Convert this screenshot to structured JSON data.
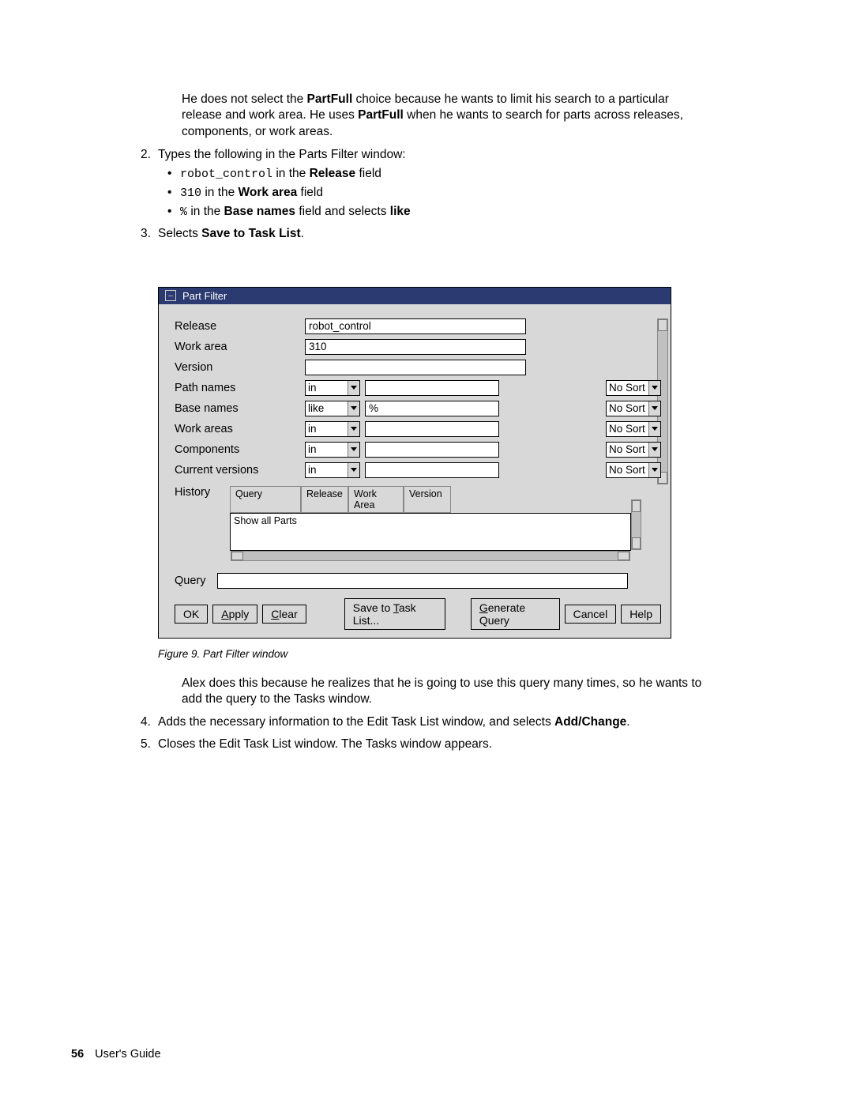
{
  "intro": {
    "p1a": "He does not select the ",
    "partfull1": "PartFull",
    "p1b": " choice because he wants to limit his search to a particular release and work area. He uses ",
    "partfull2": "PartFull",
    "p1c": " when he wants to search for parts across releases, components, or work areas."
  },
  "step2": {
    "num": "2.",
    "lead": "Types the following in the Parts Filter window:",
    "b1_code": "robot_control",
    "b1_mid": " in the ",
    "b1_field": "Release",
    "b1_end": " field",
    "b2_code": "310",
    "b2_mid": " in the ",
    "b2_field": "Work area",
    "b2_end": " field",
    "b3_code": "%",
    "b3_mid": " in the ",
    "b3_field": "Base names",
    "b3_mid2": " field and selects ",
    "b3_like": "like"
  },
  "step3": {
    "num": "3.",
    "a": "Selects ",
    "b": "Save to Task List",
    "c": "."
  },
  "window": {
    "title": "Part Filter",
    "labels": {
      "release": "Release",
      "workarea": "Work area",
      "version": "Version",
      "pathnames": "Path names",
      "basenames": "Base names",
      "workareas": "Work areas",
      "components": "Components",
      "currentversions": "Current versions",
      "history": "History",
      "query": "Query"
    },
    "values": {
      "release": "robot_control",
      "workarea": "310",
      "version": "",
      "basenames_val": "%"
    },
    "ops": {
      "in": "in",
      "like": "like"
    },
    "sort": "No Sort",
    "history_headers": {
      "query": "Query",
      "release": "Release",
      "workarea": "Work Area",
      "version": "Version"
    },
    "history_item": "Show all Parts",
    "buttons": {
      "ok": "OK",
      "apply_u": "A",
      "apply_rest": "pply",
      "clear_u": "C",
      "clear_rest": "lear",
      "save_pre": "Save to ",
      "save_u": "T",
      "save_rest": "ask List...",
      "gen_u": "G",
      "gen_rest": "enerate Query",
      "cancel": "Cancel",
      "help": "Help"
    }
  },
  "figcap": "Figure 9. Part Filter window",
  "after": {
    "p1": "Alex does this because he realizes that he is going to use this query many times, so he wants to add the query to the Tasks window.",
    "s4num": "4.",
    "s4a": "Adds the necessary information to the Edit Task List window, and selects ",
    "s4b": "Add/Change",
    "s4c": ".",
    "s5num": "5.",
    "s5": "Closes the Edit Task List window. The Tasks window appears."
  },
  "footer": {
    "page": "56",
    "title": "User's Guide"
  }
}
